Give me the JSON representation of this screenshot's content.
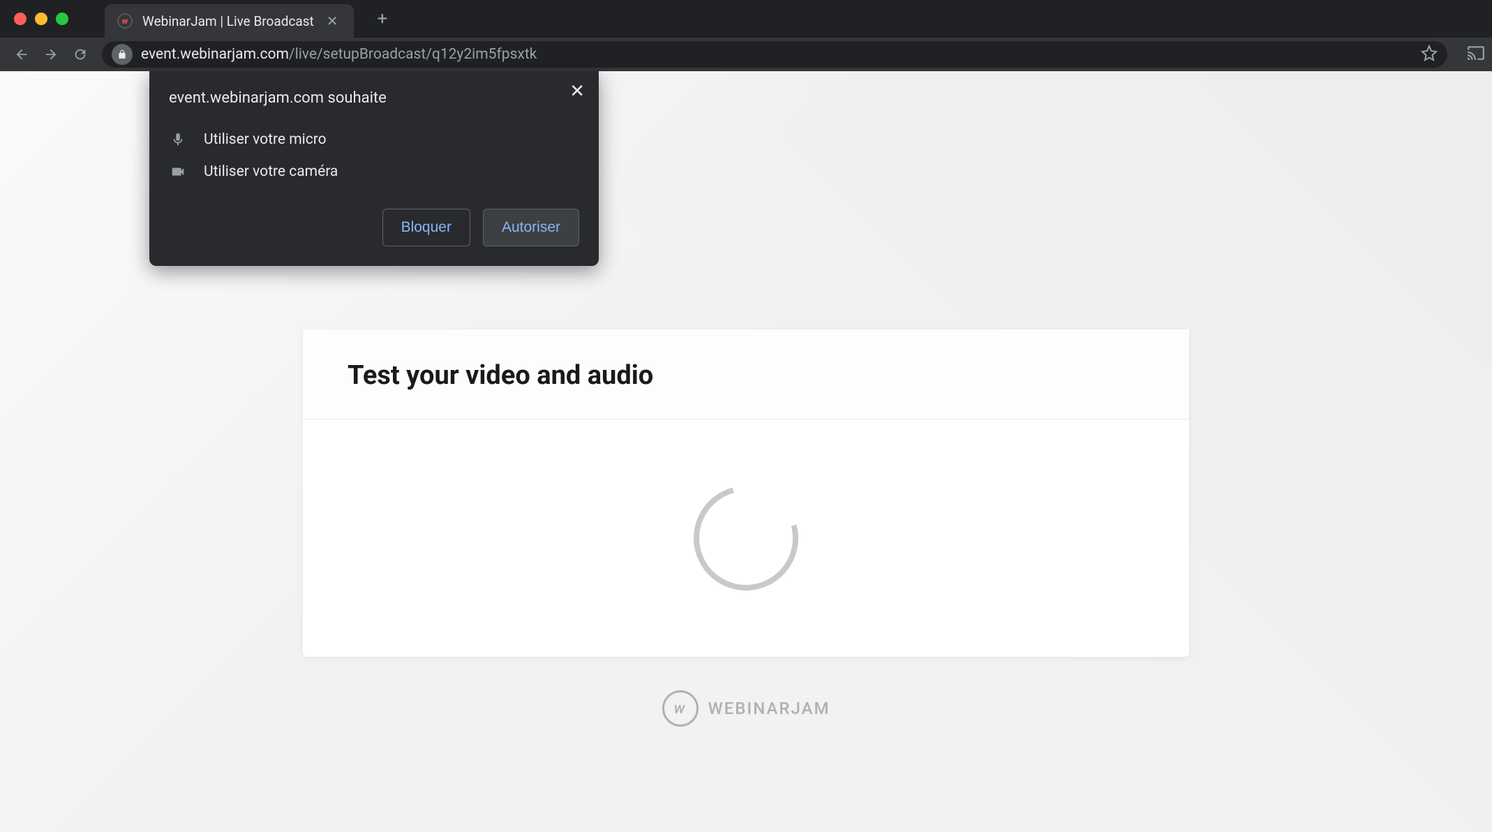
{
  "browser": {
    "tab": {
      "title": "WebinarJam | Live Broadcast",
      "favicon_letter": "w"
    },
    "address": {
      "domain": "event.webinarjam.com",
      "path": "/live/setupBroadcast/q12y2im5fpsxtk"
    }
  },
  "permission": {
    "title": "event.webinarjam.com souhaite",
    "items": [
      {
        "icon": "microphone",
        "label": "Utiliser votre micro"
      },
      {
        "icon": "camera",
        "label": "Utiliser votre caméra"
      }
    ],
    "block_label": "Bloquer",
    "allow_label": "Autoriser"
  },
  "page": {
    "card_title": "Test your video and audio",
    "brand": "WEBINARJAM",
    "brand_letter": "w"
  }
}
